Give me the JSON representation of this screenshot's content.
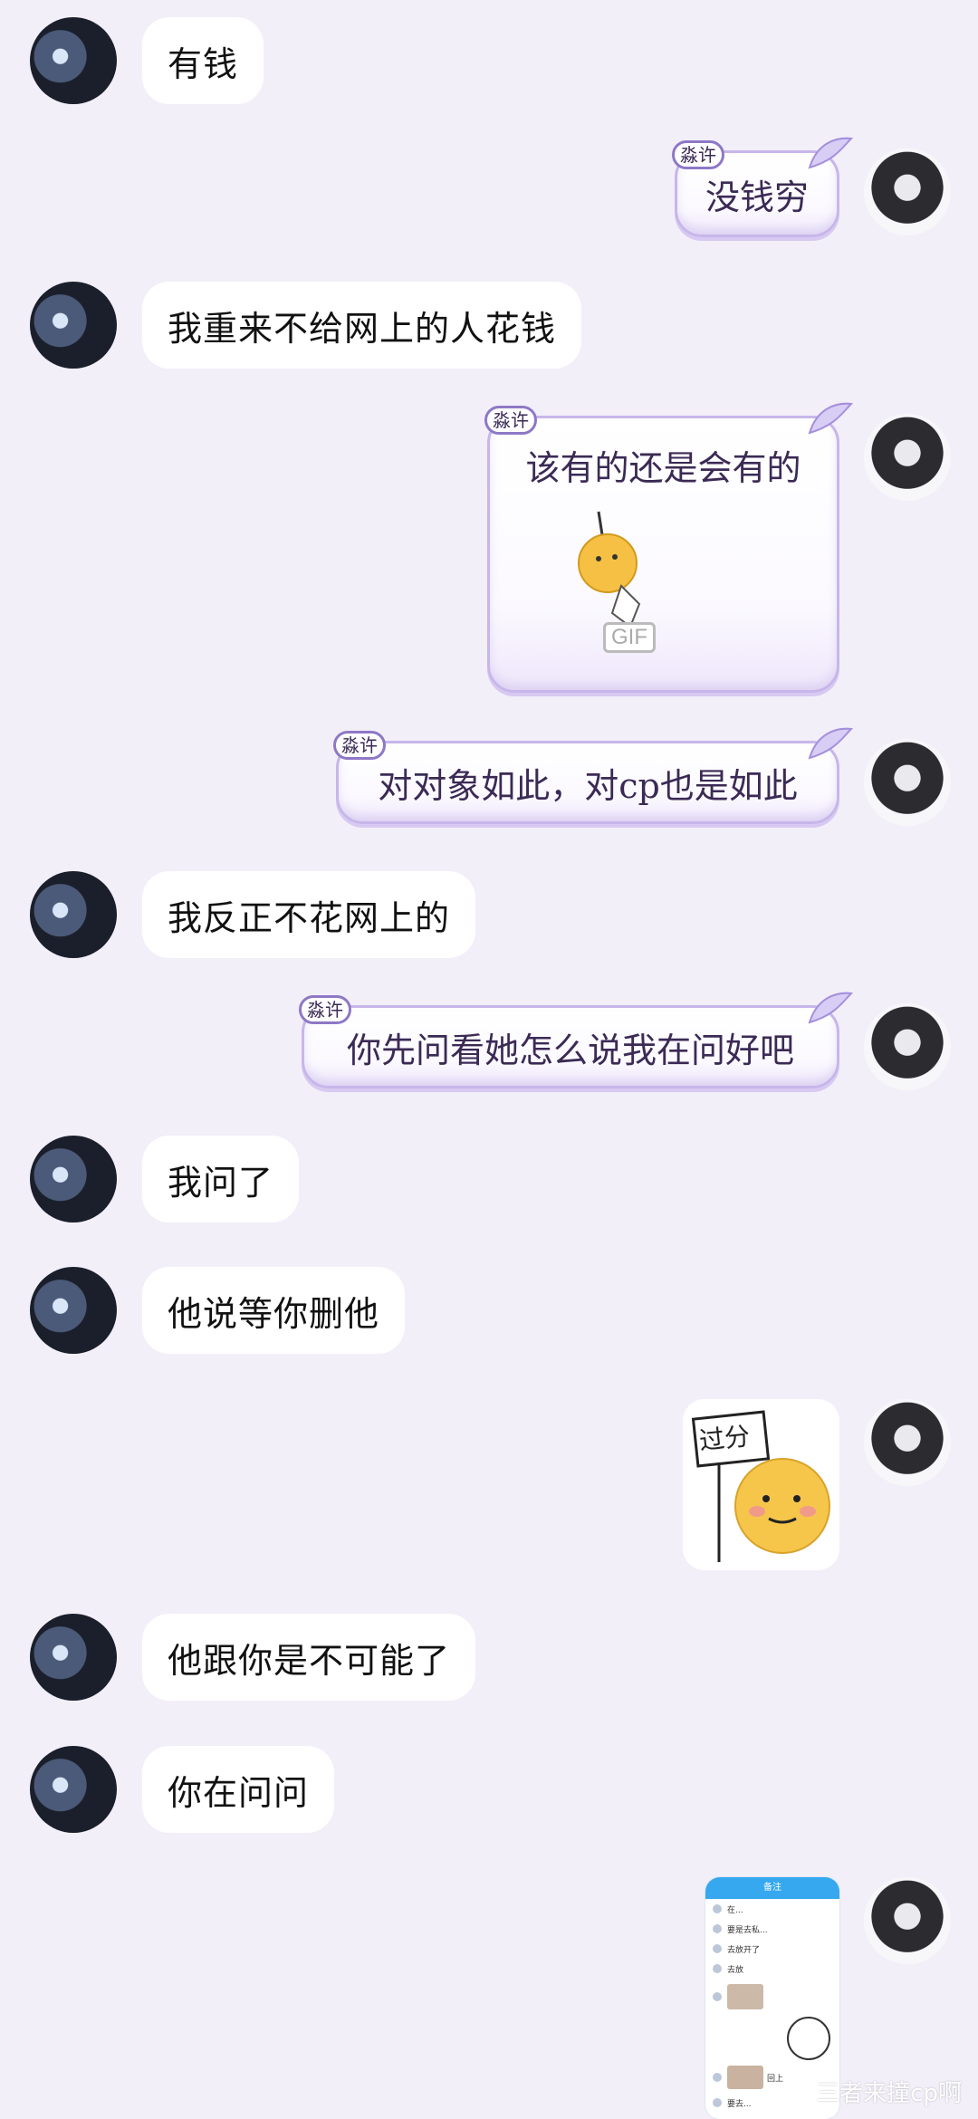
{
  "tag_label": "淼许",
  "messages_left": [
    {
      "text": "有钱"
    },
    {
      "text": "我重来不给网上的人花钱"
    },
    {
      "text": "我反正不花网上的"
    },
    {
      "text": "我问了"
    },
    {
      "text": "他说等你删他"
    },
    {
      "text": "他跟你是不可能了"
    },
    {
      "text": "你在问问"
    }
  ],
  "messages_right": [
    {
      "text": "没钱穷"
    },
    {
      "text": "该有的还是会有的"
    },
    {
      "text": "对对象如此，对cp也是如此"
    },
    {
      "text": "你先问看她怎么说我在问好吧"
    }
  ],
  "stickers": {
    "gif_badge": "GIF",
    "sign_text": "过分"
  },
  "screenshot_preview": {
    "header": "备注",
    "rows": [
      "在...",
      "要是去私...",
      "去放开了",
      "去放",
      "",
      "",
      "回上",
      "要去..."
    ]
  },
  "watermark": "三者来撞cp啊"
}
